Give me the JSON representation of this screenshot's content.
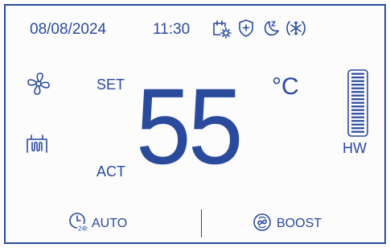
{
  "status_bar": {
    "date": "08/08/2024",
    "time": "11:30",
    "icons": [
      "calendar-sun-icon",
      "shield-plus-icon",
      "moon-z-icon",
      "antifreeze-icon"
    ]
  },
  "main": {
    "set_label": "SET",
    "act_label": "ACT",
    "temperature": "55",
    "unit": "°C",
    "left_icons": [
      "fan-icon",
      "heating-coil-icon"
    ],
    "tank_label": "HW",
    "tank_level": 1.0
  },
  "bottom_bar": {
    "auto_label": "AUTO",
    "auto_icon_text": "24h",
    "boost_label": "BOOST"
  },
  "colors": {
    "accent": "#2a4a9c",
    "background": "#fcfcfd"
  }
}
